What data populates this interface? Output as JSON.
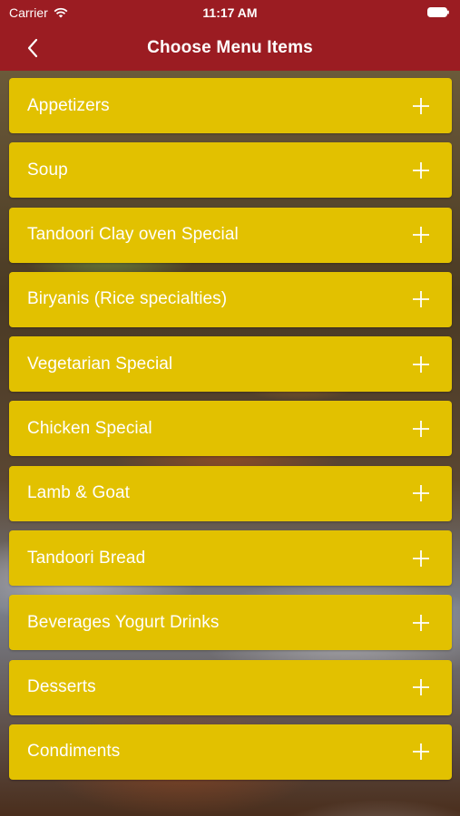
{
  "status_bar": {
    "carrier": "Carrier",
    "time": "11:17 AM",
    "icons": [
      "wifi-icon",
      "battery-icon"
    ]
  },
  "nav": {
    "title": "Choose Menu Items",
    "back_icon": "chevron-left-icon"
  },
  "colors": {
    "nav_background": "#9b1c22",
    "item_background": "#e2c100",
    "item_text": "#ffffff"
  },
  "menu": {
    "expand_icon": "plus-icon",
    "items": [
      {
        "label": "Appetizers"
      },
      {
        "label": "Soup"
      },
      {
        "label": "Tandoori Clay oven Special"
      },
      {
        "label": "Biryanis (Rice specialties)"
      },
      {
        "label": "Vegetarian Special"
      },
      {
        "label": "Chicken Special"
      },
      {
        "label": "Lamb & Goat"
      },
      {
        "label": "Tandoori Bread"
      },
      {
        "label": "Beverages Yogurt Drinks"
      },
      {
        "label": "Desserts"
      },
      {
        "label": "Condiments"
      }
    ]
  }
}
